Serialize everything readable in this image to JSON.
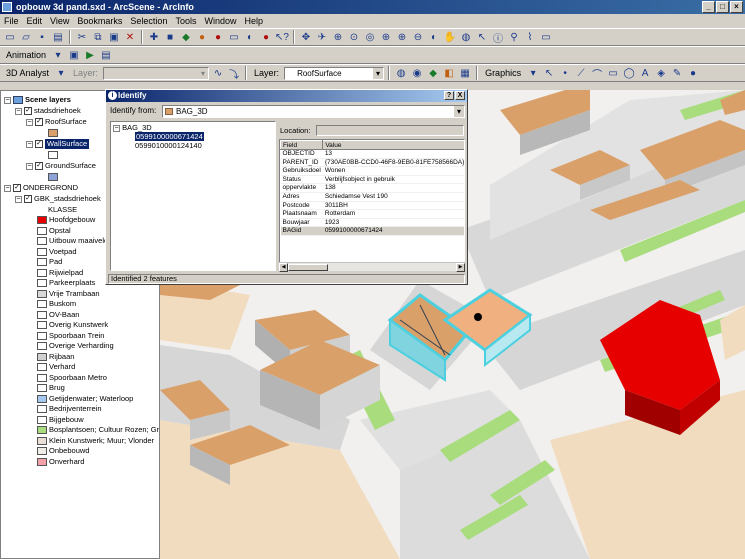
{
  "window": {
    "title": "opbouw 3d pand.sxd - ArcScene - ArcInfo"
  },
  "menu": [
    "File",
    "Edit",
    "View",
    "Bookmarks",
    "Selection",
    "Tools",
    "Window",
    "Help"
  ],
  "toolbar3": {
    "animation_label": "Animation",
    "analyst_label": "3D Analyst",
    "analyst_layer_label": "Layer:",
    "layer_label": "Layer:",
    "layer_value": "RoofSurface",
    "graphics_label": "Graphics"
  },
  "toc": {
    "title": "Scene layers",
    "items": [
      {
        "label": "stadsdriehoek"
      },
      {
        "label": "RoofSurface",
        "color": "#d9a06a"
      },
      {
        "label": "WallSurface",
        "color": "#ffffff"
      },
      {
        "label": "GroundSurface",
        "color": "#8ca3d8"
      },
      {
        "label": "ONDERGROND"
      },
      {
        "label": "GBK_stadsdriehoek"
      },
      {
        "label": "KLASSE"
      }
    ],
    "legend": [
      {
        "label": "Hoofdgebouw",
        "color": "#e60000"
      },
      {
        "label": "Opstal",
        "color": "#ffffff"
      },
      {
        "label": "Uitbouw maaiveld",
        "color": "#ffffff"
      },
      {
        "label": "Voetpad",
        "color": "#ffffff"
      },
      {
        "label": "Pad",
        "color": "#ffffff"
      },
      {
        "label": "Rijwielpad",
        "color": "#ffffff"
      },
      {
        "label": "Parkeerplaats",
        "color": "#ffffff"
      },
      {
        "label": "Vrije Trambaan",
        "color": "#d8d8d8"
      },
      {
        "label": "Buskom",
        "color": "#ffffff"
      },
      {
        "label": "OV-Baan",
        "color": "#ffffff"
      },
      {
        "label": "Overig Kunstwerk",
        "color": "#ffffff"
      },
      {
        "label": "Spoorbaan Trein",
        "color": "#ffffff"
      },
      {
        "label": "Overige Verharding",
        "color": "#ffffff"
      },
      {
        "label": "Rijbaan",
        "color": "#d0d0d0"
      },
      {
        "label": "Verhard",
        "color": "#ffffff"
      },
      {
        "label": "Spoorbaan Metro",
        "color": "#ffffff"
      },
      {
        "label": "Brug",
        "color": "#ffffff"
      },
      {
        "label": "Getijdenwater; Waterloop",
        "color": "#a6c8f0"
      },
      {
        "label": "Bedrijventerrein",
        "color": "#ffffff"
      },
      {
        "label": "Bijgebouw",
        "color": "#ffffff"
      },
      {
        "label": "Bosplantsoen; Cultuur Rozen; Gras; Gr",
        "color": "#a8dc7c"
      },
      {
        "label": "Klein Kunstwerk; Muur; Vlonder",
        "color": "#e8e0d8"
      },
      {
        "label": "Onbebouwd",
        "color": "#f0ece8"
      },
      {
        "label": "Onverhard",
        "color": "#f4a0a8"
      }
    ]
  },
  "identify": {
    "title": "Identify",
    "help_btn": "?",
    "close_btn": "X",
    "identify_from_label": "Identify from:",
    "identify_from_value": "BAG_3D",
    "tree_root": "BAG_3D",
    "tree_items": [
      "0599100000671424",
      "0599010000124140"
    ],
    "location_label": "Location:",
    "col_field": "Field",
    "col_value": "Value",
    "rows": [
      {
        "field": "OBJECTID",
        "value": "13"
      },
      {
        "field": "PARENT_ID",
        "value": "{730AE0BB-CCD0-46F8-9EB0-81FE758566DA}"
      },
      {
        "field": "Gebruiksdoel",
        "value": "Wonen"
      },
      {
        "field": "Status",
        "value": "Verblijfsobject in gebruik"
      },
      {
        "field": "oppervlakte",
        "value": "138"
      },
      {
        "field": "Adres",
        "value": "Schiedamse Vest 190"
      },
      {
        "field": "Postcode",
        "value": "3011BH"
      },
      {
        "field": "Plaatsnaam",
        "value": "Rotterdam"
      },
      {
        "field": "Bouwjaar",
        "value": "1923"
      },
      {
        "field": "BAGid",
        "value": "0599100000671424"
      }
    ],
    "status": "Identified 2 features"
  },
  "icons": {
    "colors": {
      "roof": "#d9a06a",
      "road": "#d6d6d6",
      "grass": "#a8dc7c",
      "main_building": "#e60000",
      "selected_outline": "#4bd0e0"
    }
  }
}
